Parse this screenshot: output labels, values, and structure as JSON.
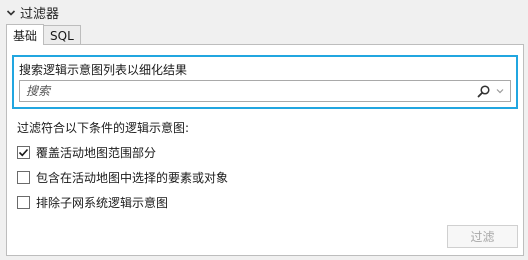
{
  "section": {
    "title": "过滤器",
    "icon": "chevron-down-icon"
  },
  "tabs": [
    {
      "label": "基础",
      "active": true
    },
    {
      "label": "SQL",
      "active": false
    }
  ],
  "search": {
    "label": "搜索逻辑示意图列表以细化结果",
    "placeholder": "搜索",
    "value": "",
    "search_icon": "search-icon",
    "dropdown_icon": "dropdown-arrow-icon",
    "highlight_color": "#21a6e0"
  },
  "filters": {
    "heading": "过滤符合以下条件的逻辑示意图:",
    "options": [
      {
        "label": "覆盖活动地图范围部分",
        "checked": true
      },
      {
        "label": "包含在活动地图中选择的要素或对象",
        "checked": false
      },
      {
        "label": "排除子网系统逻辑示意图",
        "checked": false
      }
    ]
  },
  "actions": {
    "filter_label": "过滤",
    "filter_enabled": false
  }
}
